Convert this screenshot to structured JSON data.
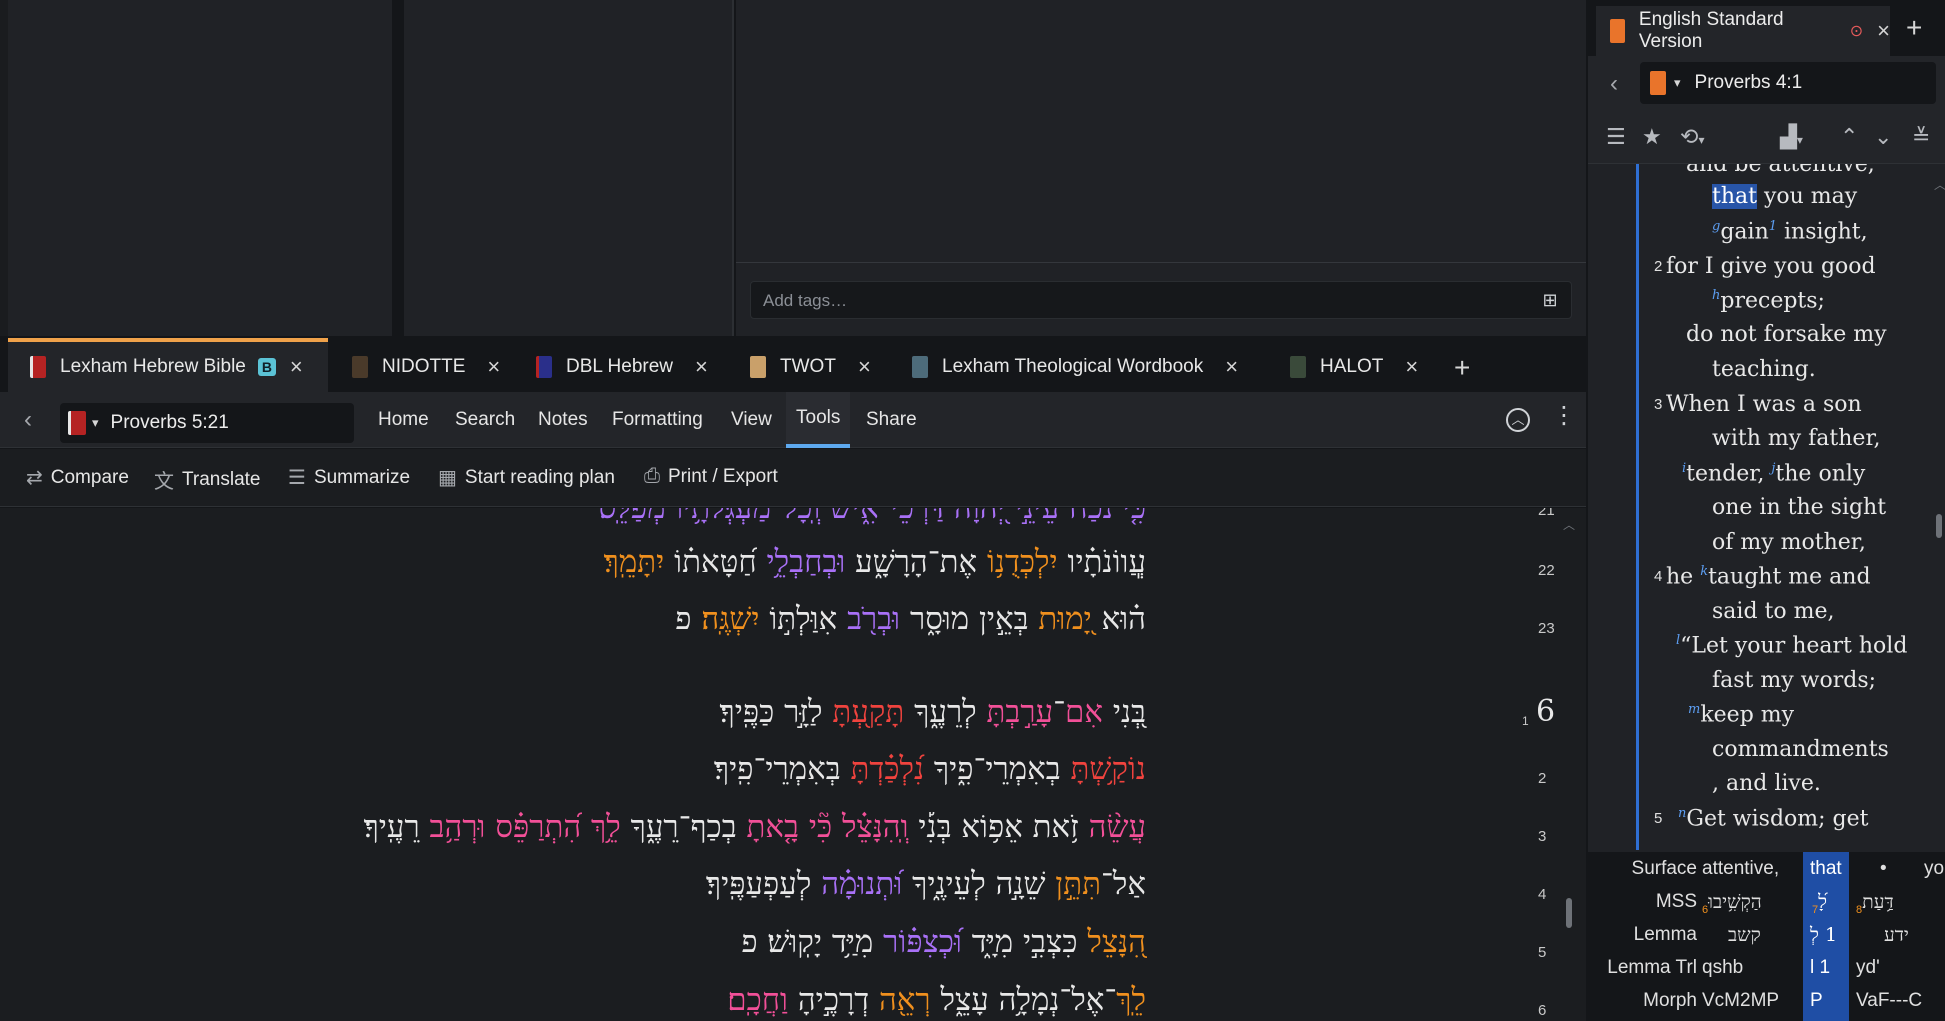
{
  "tags_placeholder": "Add tags…",
  "tabs": [
    {
      "label": "Lexham Hebrew Bible",
      "badge": "B",
      "color": "#b52323"
    },
    {
      "label": "NIDOTTE",
      "color": "#4a3a2a"
    },
    {
      "label": "DBL Hebrew",
      "color": "#2a2f8a"
    },
    {
      "label": "TWOT",
      "color": "#c9a06a"
    },
    {
      "label": "Lexham Theological Wordbook",
      "color": "#4d6b7a"
    },
    {
      "label": "HALOT",
      "color": "#3a4a3a"
    }
  ],
  "nav": {
    "reference": "Proverbs 5:21",
    "menus": [
      "Home",
      "Search",
      "Notes",
      "Formatting",
      "View",
      "Tools",
      "Share"
    ],
    "active_menu": "Tools"
  },
  "tools": [
    "Compare",
    "Translate",
    "Summarize",
    "Start reading plan",
    "Print / Export"
  ],
  "hebrew": {
    "lines": [
      {
        "verse": "21",
        "text": "כִּ֤י נֹ֨כַח עֵינֵ֣י יְ֭הוָה דַּרְכֵי־אִ֑ישׁ וְֽכָל־מַעְגְּלֹתָ֥יו מְפַלֵּֽס׃"
      },
      {
        "verse": "22",
        "a": "עֲֽווֹנֹתָ֗יו ",
        "b": "יִלְכְּדֻנ֥וֹ",
        "c": " אֶת־הָרָשָׁ֑ע ",
        "d": "וּבְחַבְלֵ֥י",
        "e": " חַ֝טָּאת֗וֹ ",
        "f": "יִתָּמֵֽךְ׃"
      },
      {
        "verse": "23",
        "a": "ה֗וּא ",
        "b": "יָ֭מוּת",
        "c": " בְּאֵ֣ין מוּסָ֑ר ",
        "d": "וּבְרֹ֖ב",
        "e": " אִוַּלְתּ֣וֹ ",
        "f": "יִשְׁגֶּֽה׃",
        "g": " פ"
      },
      {
        "chapter": "6",
        "verse": "1",
        "a": "בְּ֭נִי ",
        "b": "אִם",
        "c": "־",
        "d": "עָרַ֣בְתָּ",
        "e": " לְרֵעֶ֑ךָ ",
        "f": "תָּקַ֖עְתָּ",
        "g": " לַזָּ֣ר כַּפֶּֽיךָ׃"
      },
      {
        "verse": "2",
        "a": "נוֹקַ֥שְׁתָּ",
        "b": " בְאִמְרֵי־פִ֑יךָ ",
        "c": "נִ֝לְכַּ֗דְתָּ",
        "d": " בְּאִמְרֵי־פִֽיךָ׃"
      },
      {
        "verse": "3",
        "a": "עֲשֵׂ֨ה",
        "b": " זֹ֥את אֵפ֥וֹא בְּנִ֡י ",
        "c": "וְֽהִנָּצֵ֗ל",
        "d": " ",
        "e": "כִּ֘י",
        "f": " ",
        "g": "בָ֤אתָ",
        "h": " בְכַף־רֵעֶ֑ךָ ",
        "i": "לֵ֥ךְ",
        "j": " ",
        "k": "הִ֝תְרַפֵּ֗ס",
        "l": " ",
        "m": "וּרְהַ֥ב",
        "n": " רֵעֶֽיךָ׃"
      },
      {
        "verse": "4",
        "a": "אַל־",
        "b": "תִּתֵּ֣ן",
        "c": " שֵׁנָ֣ה לְעֵינֶ֑יךָ ",
        "d": "וּ֝תְנוּמָ֗ה",
        "e": " לְעַפְעַפֶּֽיךָ׃"
      },
      {
        "verse": "5",
        "a": "הִ֭נָּצֵל",
        "b": " כִּצְבִ֣י מִיָּ֑ד ",
        "c": "וּ֝כְצִפּ֗וֹר",
        "d": " מִיַּ֥ד יָקֽוּשׁ׃ פ"
      },
      {
        "verse": "6",
        "a": "לֵֽךְ",
        "b": "־אֶל־נְמָלָ֥ה עָצֵ֑ל ",
        "c": "רְאֵ֖ה",
        "d": " דְרָכֶ֣יהָ ",
        "e": "וַחֲכָֽם׃"
      }
    ]
  },
  "esv": {
    "tab_label": "English Standard Version",
    "reference": "Proverbs 4:1",
    "lines": [
      {
        "indent": 2,
        "text": "and be attentive,"
      },
      {
        "indent": 3,
        "pre_hl": "",
        "hl": "that",
        "post": " you may"
      },
      {
        "indent": 3,
        "fn": "g",
        "text": "gain",
        "fn2": "1",
        "tail": " insight,"
      },
      {
        "verse": "2",
        "indent": 1,
        "text": "for I give you good"
      },
      {
        "indent": 3,
        "fn": "h",
        "text": "precepts;"
      },
      {
        "indent": 2,
        "text": "do not forsake my"
      },
      {
        "indent": 3,
        "text": "teaching."
      },
      {
        "verse": "3",
        "indent": 1,
        "text": "When I was a son"
      },
      {
        "indent": 3,
        "text": "with my father,"
      },
      {
        "indent": 2,
        "fn": "i",
        "text": "tender, ",
        "fn2b": "j",
        "tail": "the only"
      },
      {
        "indent": 3,
        "text": "one in the sight"
      },
      {
        "indent": 3,
        "text": "of my mother,"
      },
      {
        "verse": "4",
        "indent": 1,
        "text": "he ",
        "fn_mid": "k",
        "tail": "taught me and"
      },
      {
        "indent": 3,
        "text": "said to me,"
      },
      {
        "indent": 1,
        "fn": "l",
        "text": "“Let your heart hold"
      },
      {
        "indent": 3,
        "text": "fast my words;"
      },
      {
        "indent": 2,
        "fn": "m",
        "text": "keep my"
      },
      {
        "indent": 3,
        "text": "commandments"
      },
      {
        "indent": 3,
        "text": ", and live."
      },
      {
        "verse": "5",
        "indent": 1,
        "fn": "n",
        "text": "Get wisdom; get"
      }
    ]
  },
  "interlinear": {
    "rows": [
      {
        "label": "Surface",
        "c1": "attentive,",
        "c2": "that",
        "c3": "•",
        "c4": "yo"
      },
      {
        "label": "MSS",
        "c1": "הַקְשִׁ֥יבוּ",
        "c1n": "6",
        "c2": "לָ֝",
        "c2n": "7",
        "c3": "דַּ֥עַת",
        "c3n": "8"
      },
      {
        "label": "Lemma",
        "c1": "קשב",
        "c2": "1 לְ",
        "c3": "ידע"
      },
      {
        "label": "Lemma Trl",
        "c1": "qshb",
        "c2": "l 1",
        "c3": "yd'"
      },
      {
        "label": "Morph",
        "c1": "VcM2MP",
        "c2": "P",
        "c3": "VaF---C"
      }
    ]
  }
}
